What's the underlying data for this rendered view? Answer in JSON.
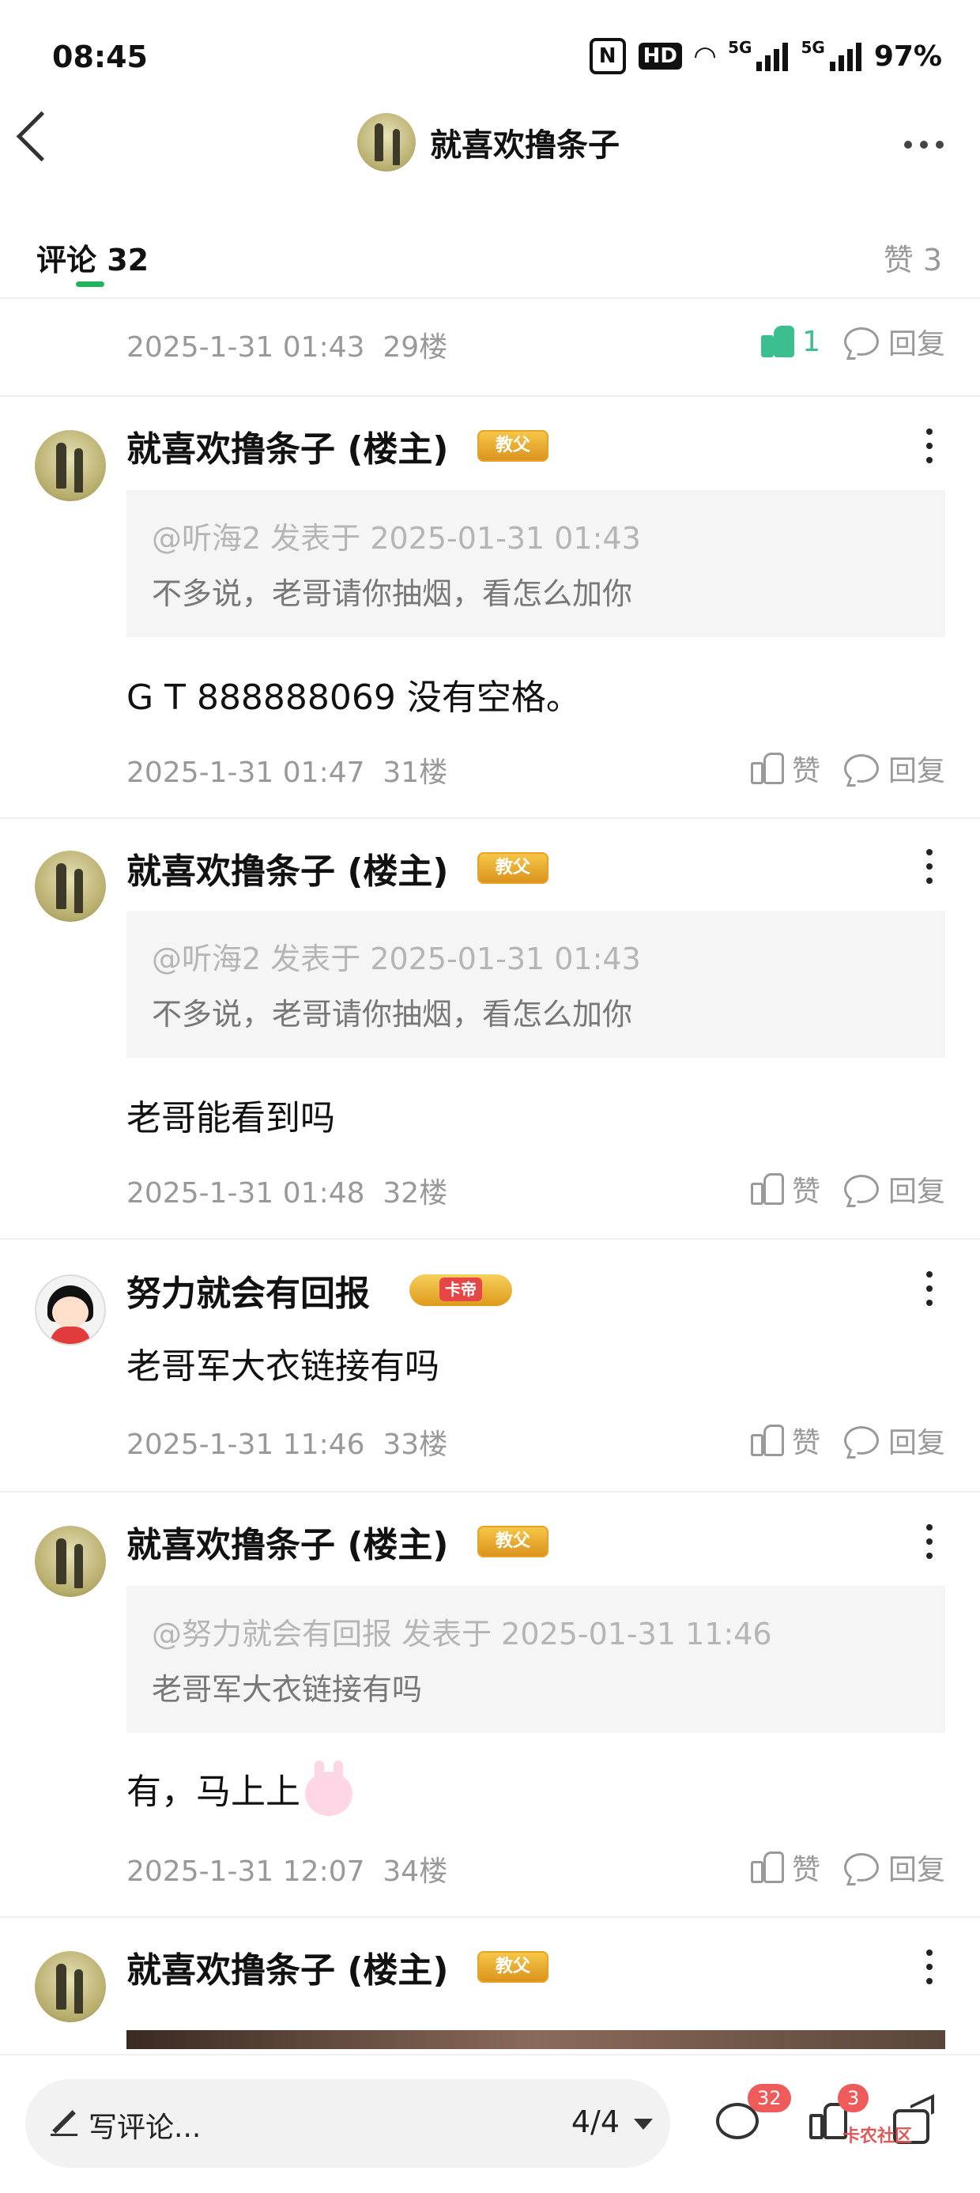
{
  "status_bar": {
    "time": "08:45",
    "battery": "97%",
    "hd_label": "HD",
    "signal_label": "5G"
  },
  "nav": {
    "title": "就喜欢撸条子"
  },
  "tabs": {
    "comments_label": "评论 32",
    "likes_label": "赞 3"
  },
  "partial_row": {
    "date": "2025-1-31 01:43",
    "floor": "29楼",
    "like_count": "1",
    "reply_label": "回复"
  },
  "comments": [
    {
      "user": "就喜欢撸条子 (楼主)",
      "badge": "教父",
      "quote_header": "@听海2 发表于 2025-01-31 01:43",
      "quote_body": "不多说，老哥请你抽烟，看怎么加你",
      "text": "G  T  888888069  没有空格。",
      "date": "2025-1-31 01:47",
      "floor": "31楼",
      "like_label": "赞",
      "reply_label": "回复"
    },
    {
      "user": "就喜欢撸条子 (楼主)",
      "badge": "教父",
      "quote_header": "@听海2 发表于 2025-01-31 01:43",
      "quote_body": "不多说，老哥请你抽烟，看怎么加你",
      "text": "老哥能看到吗",
      "date": "2025-1-31 01:48",
      "floor": "32楼",
      "like_label": "赞",
      "reply_label": "回复"
    },
    {
      "user": "努力就会有回报",
      "badge": "卡帝",
      "text": "老哥军大衣链接有吗",
      "date": "2025-1-31 11:46",
      "floor": "33楼",
      "like_label": "赞",
      "reply_label": "回复"
    },
    {
      "user": "就喜欢撸条子 (楼主)",
      "badge": "教父",
      "quote_header": "@努力就会有回报 发表于 2025-01-31 11:46",
      "quote_body": "老哥军大衣链接有吗",
      "text": "有，马上上",
      "date": "2025-1-31 12:07",
      "floor": "34楼",
      "like_label": "赞",
      "reply_label": "回复"
    },
    {
      "user": "就喜欢撸条子 (楼主)",
      "badge": "教父"
    }
  ],
  "bottom_bar": {
    "write_placeholder": "写评论...",
    "page_indicator": "4/4",
    "comment_count": "32",
    "like_count": "3",
    "watermark": "卡农社区"
  },
  "colors": {
    "accent_green": "#22b45a",
    "liked_green": "#3cbf8f",
    "badge_red": "#ef5a5a"
  }
}
